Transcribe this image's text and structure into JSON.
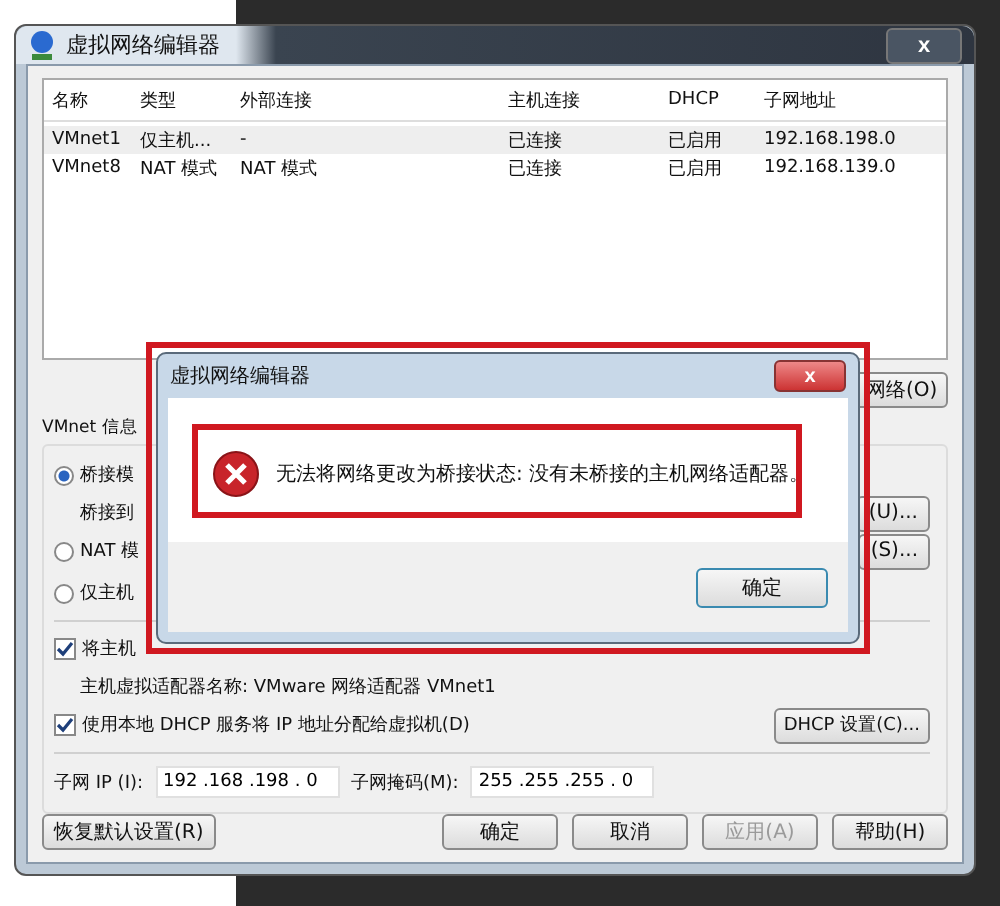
{
  "window": {
    "title": "虚拟网络编辑器",
    "close": "x"
  },
  "table": {
    "columns": [
      "名称",
      "类型",
      "外部连接",
      "主机连接",
      "DHCP",
      "子网地址"
    ],
    "rows": [
      {
        "cells": [
          "VMnet1",
          "仅主机...",
          "-",
          "已连接",
          "已启用",
          "192.168.198.0"
        ],
        "selected": true
      },
      {
        "cells": [
          "VMnet8",
          "NAT 模式",
          "NAT 模式",
          "已连接",
          "已启用",
          "192.168.139.0"
        ],
        "selected": false
      }
    ]
  },
  "add_network_button": "网络(O)",
  "vmnet_info": {
    "label": "VMnet 信息",
    "modes": [
      {
        "label": "桥接模",
        "selected": true
      },
      {
        "label": "NAT 模",
        "selected": false
      },
      {
        "label": "仅主机",
        "selected": false
      }
    ],
    "bridge_to": "桥接到",
    "auto_settings_button": "(U)...",
    "nat_settings_button": "(S)...",
    "connect_host": {
      "label": "将主机",
      "checked": true
    },
    "adapter_name": "主机虚拟适配器名称: VMware 网络适配器 VMnet1",
    "use_dhcp": {
      "label": "使用本地 DHCP 服务将 IP 地址分配给虚拟机(D)",
      "checked": true
    },
    "dhcp_settings_button": "DHCP 设置(C)...",
    "subnet_ip_label": "子网 IP (I):",
    "subnet_ip": "192 .168 .198 . 0",
    "subnet_mask_label": "子网掩码(M):",
    "subnet_mask": "255 .255 .255 . 0"
  },
  "footer": {
    "restore": "恢复默认设置(R)",
    "ok": "确定",
    "cancel": "取消",
    "apply": {
      "label": "应用(A)",
      "disabled": true
    },
    "help": "帮助(H)"
  },
  "error_dialog": {
    "title": "虚拟网络编辑器",
    "close": "x",
    "message": "无法将网络更改为桥接状态: 没有未桥接的主机网络适配器。",
    "ok": "确定"
  }
}
